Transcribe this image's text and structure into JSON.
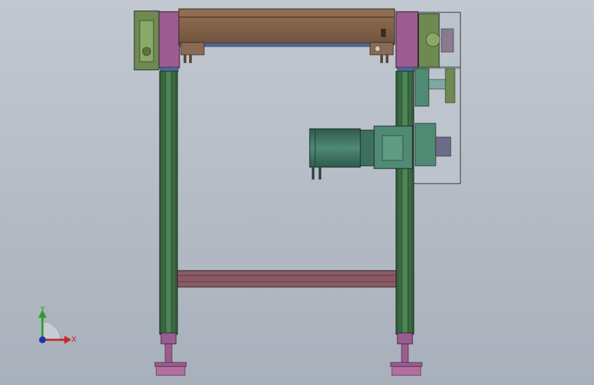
{
  "viewport": {
    "background_top": "#c2c8d0",
    "background_bottom": "#a8b0bb"
  },
  "model": {
    "frame_color": "#3f6b45",
    "beam_color": "#7a5a58",
    "bracket_color": "#9b5c8f",
    "motor_color": "#3e7060",
    "drive_housing_color": "#bfc6ce"
  },
  "triad": {
    "y_label": "Y",
    "x_label": "X",
    "y_color": "#28a028",
    "x_color": "#c62828",
    "z_color": "#2233aa"
  }
}
